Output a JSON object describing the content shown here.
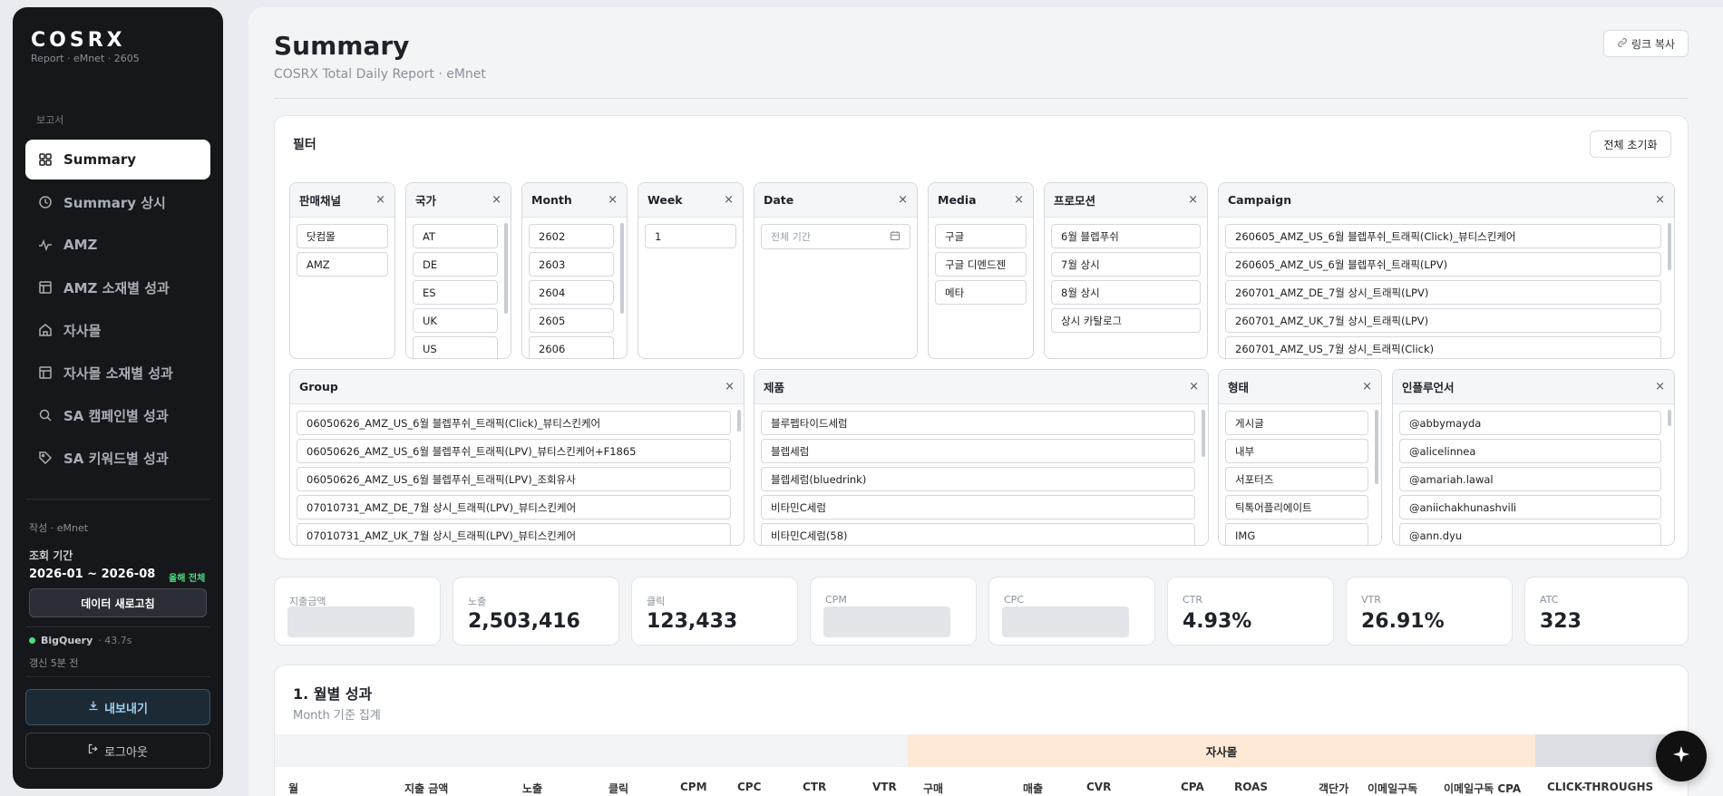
{
  "brand": {
    "name": "COSRX",
    "sub": "Report · eMnet · 2605"
  },
  "sidebar": {
    "section_label": "보고서",
    "items": [
      {
        "label": "Summary",
        "icon": "grid-icon",
        "active": true
      },
      {
        "label": "Summary 상시",
        "icon": "clock-icon"
      },
      {
        "label": "AMZ",
        "icon": "pulse-icon"
      },
      {
        "label": "AMZ 소재별 성과",
        "icon": "table-icon"
      },
      {
        "label": "자사몰",
        "icon": "home-icon"
      },
      {
        "label": "자사몰 소재별 성과",
        "icon": "table-icon"
      },
      {
        "label": "SA 캠페인별 성과",
        "icon": "search-icon"
      },
      {
        "label": "SA 키워드별 성과",
        "icon": "tag-icon"
      }
    ],
    "author": "작성 · eMnet",
    "period_label": "조회 기간",
    "period": "2026-01 ~ 2026-08",
    "period_tag": "올해 전체",
    "refresh_label": "데이터 새로고침",
    "bq_label": "BigQuery",
    "bq_latency": "· 43.7s",
    "updated": "갱신 5분 전",
    "export_label": "내보내기",
    "logout_label": "로그아웃"
  },
  "header": {
    "title": "Summary",
    "subtitle": "COSRX Total Daily Report · eMnet",
    "copy_link": "링크 복사"
  },
  "filters": {
    "title": "필터",
    "reset_label": "전체 초기화",
    "sales_channel": {
      "title": "판매채널",
      "options": [
        "닷컴몰",
        "AMZ"
      ]
    },
    "country": {
      "title": "국가",
      "options": [
        "AT",
        "DE",
        "ES",
        "UK",
        "US"
      ]
    },
    "month": {
      "title": "Month",
      "options": [
        "2602",
        "2603",
        "2604",
        "2605",
        "2606"
      ]
    },
    "week": {
      "title": "Week",
      "options": [
        "1"
      ]
    },
    "date": {
      "title": "Date",
      "placeholder": "전체 기간"
    },
    "media": {
      "title": "Media",
      "options": [
        "구글",
        "구글 디멘드젠",
        "메타"
      ]
    },
    "promotion": {
      "title": "프로모션",
      "options": [
        "6월 블렙푸쉬",
        "7월 상시",
        "8월 상시",
        "상시 카탈로그"
      ]
    },
    "campaign": {
      "title": "Campaign",
      "options": [
        "260605_AMZ_US_6월 블렙푸쉬_트래픽(Click)_뷰티스킨케어",
        "260605_AMZ_US_6월 블렙푸쉬_트래픽(LPV)",
        "260701_AMZ_DE_7월 상시_트래픽(LPV)",
        "260701_AMZ_UK_7월 상시_트래픽(LPV)",
        "260701_AMZ_US_7월 상시_트래픽(Click)"
      ]
    },
    "group": {
      "title": "Group",
      "options": [
        "06050626_AMZ_US_6월 블렙푸쉬_트래픽(Click)_뷰티스킨케어",
        "06050626_AMZ_US_6월 블렙푸쉬_트래픽(LPV)_뷰티스킨케어+F1865",
        "06050626_AMZ_US_6월 블렙푸쉬_트래픽(LPV)_조회유사",
        "07010731_AMZ_DE_7월 상시_트래픽(LPV)_뷰티스킨케어",
        "07010731_AMZ_UK_7월 상시_트래픽(LPV)_뷰티스킨케어"
      ]
    },
    "product": {
      "title": "제품",
      "options": [
        "블루펩타이드세럼",
        "블렙세럼",
        "블렙세럼(bluedrink)",
        "비타민C세럼",
        "비타민C세럼(58)"
      ]
    },
    "type": {
      "title": "형태",
      "options": [
        "게시글",
        "내부",
        "서포터즈",
        "틱톡어플리에이트",
        "IMG"
      ]
    },
    "influencer": {
      "title": "인플루언서",
      "options": [
        "@abbymayda",
        "@alicelinnea",
        "@amariah.lawal",
        "@aniichakhunashvili",
        "@ann.dyu"
      ]
    }
  },
  "kpis": [
    {
      "label": "지출금액",
      "value": null
    },
    {
      "label": "노출",
      "value": "2,503,416"
    },
    {
      "label": "클릭",
      "value": "123,433"
    },
    {
      "label": "CPM",
      "value": null
    },
    {
      "label": "CPC",
      "value": null
    },
    {
      "label": "CTR",
      "value": "4.93%"
    },
    {
      "label": "VTR",
      "value": "26.91%"
    },
    {
      "label": "ATC",
      "value": "323"
    }
  ],
  "monthly": {
    "title": "1. 월별 성과",
    "subtitle": "Month 기준 집계",
    "band_label": "자사몰",
    "columns": [
      "월",
      "지출 금액",
      "노출",
      "클릭",
      "CPM",
      "CPC",
      "CTR",
      "VTR",
      "구매",
      "매출",
      "CVR",
      "CPA",
      "ROAS",
      "객단가",
      "이메일구독",
      "이메일구독 CPA",
      "CLICK-THROUGHS"
    ]
  }
}
